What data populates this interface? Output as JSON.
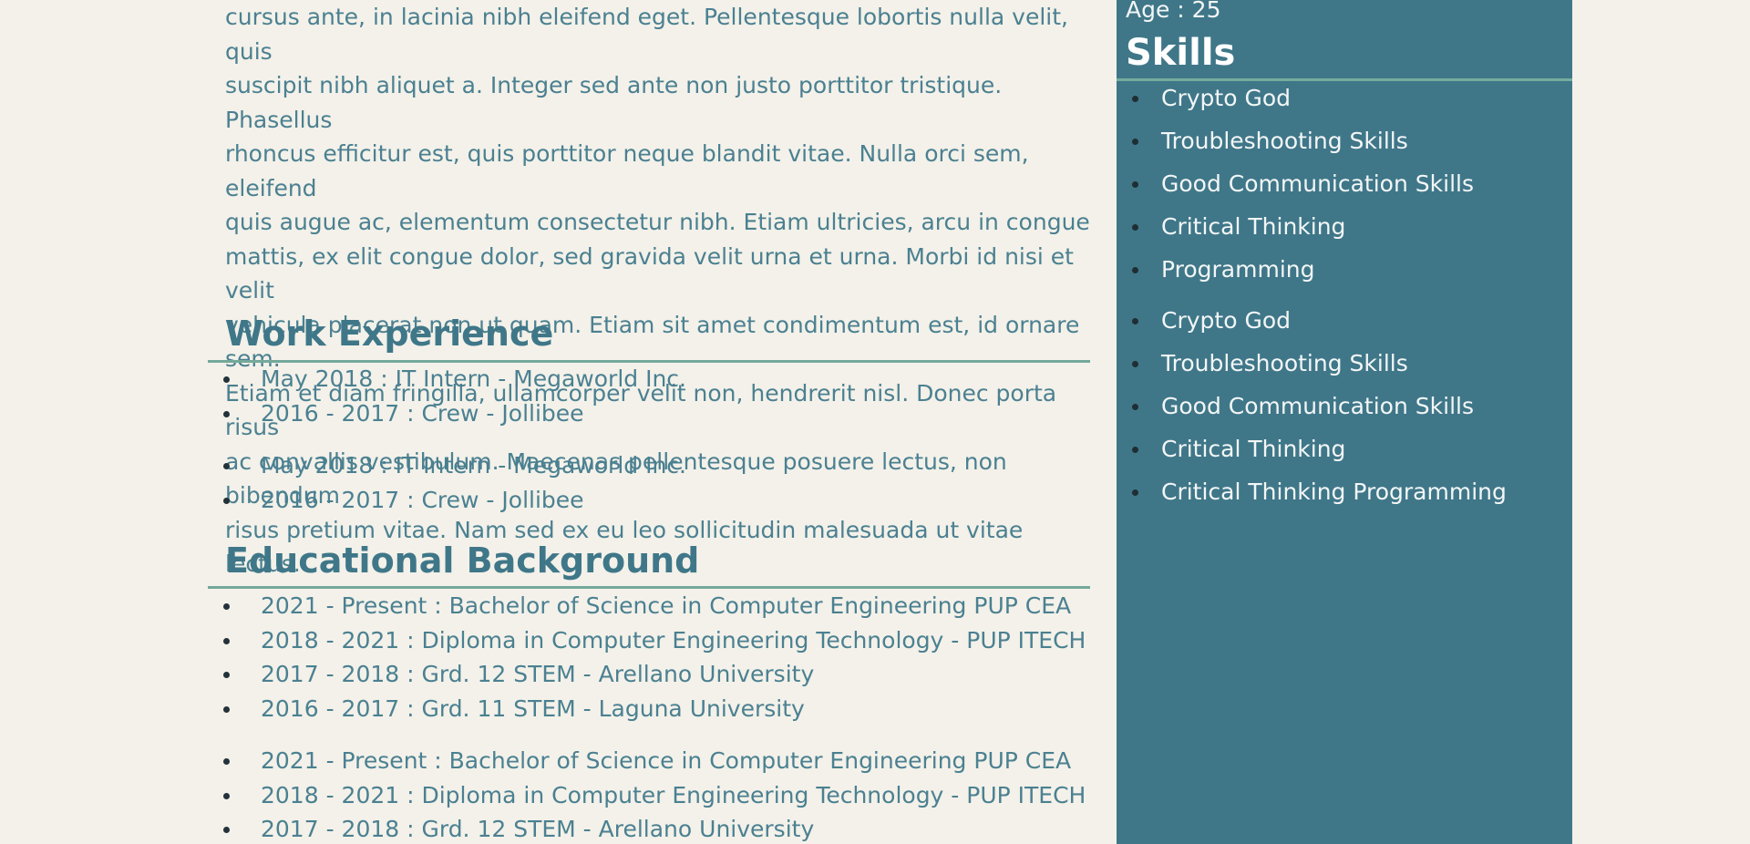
{
  "main": {
    "intro_lines": [
      "cursus ante, in lacinia nibh eleifend eget. Pellentesque lobortis nulla velit, quis",
      "suscipit nibh aliquet a. Integer sed ante non justo porttitor tristique. Phasellus",
      "rhoncus efficitur est, quis porttitor neque blandit vitae. Nulla orci sem, eleifend",
      "quis augue ac, elementum consectetur nibh. Etiam ultricies, arcu in congue",
      "mattis, ex elit congue dolor, sed gravida velit urna et urna. Morbi id nisi et velit",
      "vehicula placerat non ut quam. Etiam sit amet condimentum est, id ornare sem.",
      "Etiam et diam fringilla, ullamcorper velit non, hendrerit nisl. Donec porta risus",
      "ac convallis vestibulum. Maecenas pellentesque posuere lectus, non bibendum",
      "risus pretium vitae. Nam sed ex eu leo sollicitudin malesuada ut vitae lectus."
    ],
    "work_experience": {
      "title": "Work Experience",
      "group1": [
        "May 2018 : IT Intern - Megaworld Inc.",
        "2016 - 2017 : Crew - Jollibee"
      ],
      "group2": [
        "May 2018 : IT Intern - Megaworld Inc.",
        "2016 - 2017 : Crew - Jollibee"
      ]
    },
    "education": {
      "title": "Educational Background",
      "group1": [
        "2021 - Present : Bachelor of Science in Computer Engineering PUP CEA",
        "2018 - 2021 : Diploma in Computer Engineering Technology - PUP ITECH",
        "2017 - 2018 : Grd. 12 STEM - Arellano University",
        "2016 - 2017 : Grd. 11 STEM - Laguna University"
      ],
      "group2": [
        "2021 - Present : Bachelor of Science in Computer Engineering PUP CEA",
        "2018 - 2021 : Diploma in Computer Engineering Technology - PUP ITECH",
        "2017 - 2018 : Grd. 12 STEM - Arellano University"
      ]
    }
  },
  "sidebar": {
    "age": "Age : 25",
    "skills_title": "Skills",
    "skills_group1": [
      "Crypto God",
      "Troubleshooting Skills",
      "Good Communication Skills",
      "Critical Thinking",
      "Programming"
    ],
    "skills_group2": [
      "Crypto God",
      "Troubleshooting Skills",
      "Good Communication Skills",
      "Critical Thinking",
      "Critical Thinking Programming"
    ]
  },
  "colors": {
    "page_background": "#f3f1e9",
    "sidebar_background": "#3f7789",
    "accent_rule": "#74a99b",
    "heading_text": "#3f7789",
    "body_text": "#4b8091"
  }
}
